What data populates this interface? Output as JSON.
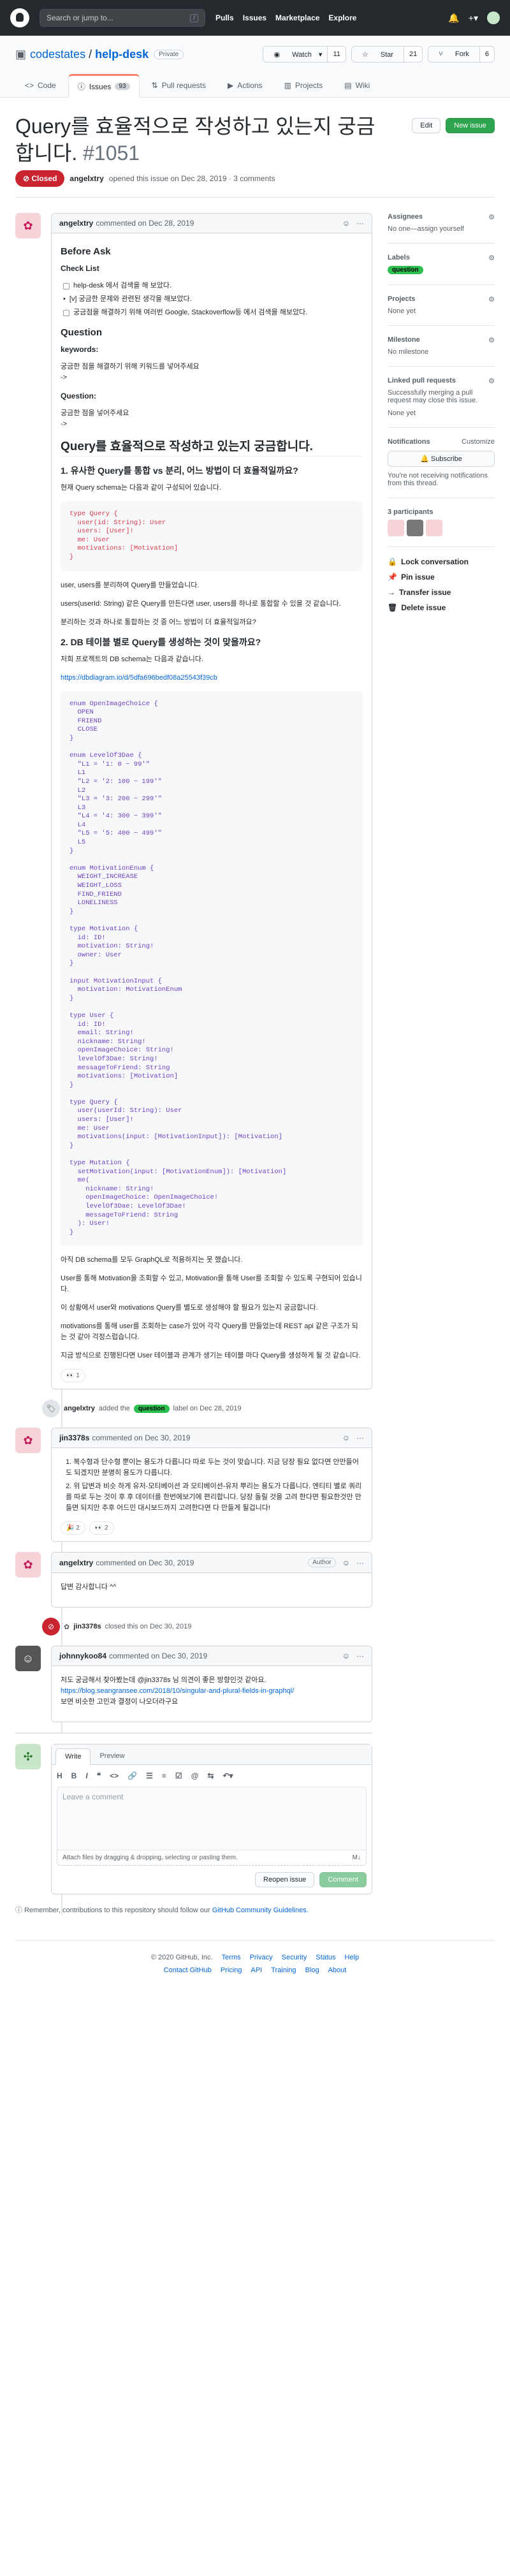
{
  "header": {
    "search_placeholder": "Search or jump to...",
    "slash": "/",
    "nav": [
      "Pulls",
      "Issues",
      "Marketplace",
      "Explore"
    ]
  },
  "repo": {
    "owner": "codestates",
    "sep": " / ",
    "name": "help-desk",
    "visibility": "Private",
    "watch": "Watch",
    "watch_count": "11",
    "star": "Star",
    "star_count": "21",
    "fork": "Fork",
    "fork_count": "6"
  },
  "tabs": [
    {
      "label": "Code"
    },
    {
      "label": "Issues",
      "count": "93"
    },
    {
      "label": "Pull requests"
    },
    {
      "label": "Actions"
    },
    {
      "label": "Projects"
    },
    {
      "label": "Wiki"
    }
  ],
  "issue": {
    "title": "Query를 효율적으로 작성하고 있는지 궁금합니다.",
    "number": "#1051",
    "edit": "Edit",
    "new_issue": "New issue",
    "state": "Closed",
    "author": "angelxtry",
    "opened_text": "opened this issue on Dec 28, 2019 · 3 comments"
  },
  "comment1": {
    "author": "angelxtry",
    "date": "commented on Dec 28, 2019",
    "h_before": "Before Ask",
    "h_check": "Check List",
    "checks": [
      "help-desk 에서 검색을 해 보았다.",
      "[v] 궁금한 문제와 관련된 생각을 해보았다.",
      "궁금점을 해결하기 위해 여러번 Google, Stackoverflow등 에서 검색을 해보았다."
    ],
    "h_question": "Question",
    "kw_label": "keywords:",
    "kw_text": "궁금한 점을 해결하기 위해 키워드를 넣어주세요",
    "arrow1": "->",
    "q_label": "Question:",
    "q_text": "궁금한 점을 넣어주세요",
    "arrow2": "->",
    "h_main": "Query를 효율적으로 작성하고 있는지 궁금합니다.",
    "h_1": "1. 유사한 Query를 통합 vs 분리, 어느 방법이 더 효율적일까요?",
    "p_1": "현재 Query schema는 다음과 같이 구성되어 있습니다.",
    "code1": "type Query {\n  user(id: String): User\n  users: [User]!\n  me: User\n  motivations: [Motivation]\n}",
    "p_2": "user, users를 분리하여 Query를 만들었습니다.",
    "p_3": "users(userId: String) 같은 Query를 만든다면 user, users를 하나로 통합할 수 있을 것 같습니다.",
    "p_4": "분리하는 것과 하나로 통합하는 것 중 어느 방법이 더 효율적일까요?",
    "h_2": "2. DB 테이블 별로 Query를 생성하는 것이 맞을까요?",
    "p_5": "저희 프로젝트의 DB schema는 다음과 같습니다.",
    "link": "https://dbdiagram.io/d/5dfa696bedf08a25543f39cb",
    "code2": "enum OpenImageChoice {\n  OPEN\n  FRIEND\n  CLOSE\n}\n\nenum LevelOf3Dae {\n  \"L1 = '1: 0 ~ 99'\"\n  L1\n  \"L2 = '2: 100 ~ 199'\"\n  L2\n  \"L3 = '3: 200 ~ 299'\"\n  L3\n  \"L4 = '4: 300 ~ 399'\"\n  L4\n  \"L5 = '5: 400 ~ 499'\"\n  L5\n}\n\nenum MotivationEnum {\n  WEIGHT_INCREASE\n  WEIGHT_LOSS\n  FIND_FRIEND\n  LONELINESS\n}\n\ntype Motivation {\n  id: ID!\n  motivation: String!\n  owner: User\n}\n\ninput MotivationInput {\n  motivation: MotivationEnum\n}\n\ntype User {\n  id: ID!\n  email: String!\n  nickname: String!\n  openImageChoice: String!\n  levelOf3Dae: String!\n  messageToFriend: String\n  motivations: [Motivation]\n}\n\ntype Query {\n  user(userId: String): User\n  users: [User]!\n  me: User\n  motivations(input: [MotivationInput]): [Motivation]\n}\n\ntype Mutation {\n  setMotivation(input: [MotivationEnum]): [Motivation]\n  me(\n    nickname: String!\n    openImageChoice: OpenImageChoice!\n    levelOf3Dae: LevelOf3Dae!\n    messageToFriend: String\n  ): User!\n}",
    "p_6": "아직 DB schema를 모두 GraphQL로 적용하지는 못 했습니다.",
    "p_7": "User를 통해 Motivation을 조회할 수 있고, Motivation을 통해 User를 조회할 수 있도록 구현되어 있습니다.",
    "p_8": "이 상황에서 user와 motivations Query를 별도로 생성해야 할 필요가 있는지 궁금합니다.",
    "p_9": "motivations를 통해 user를 조회하는 case가 있어 각각 Query를 만들었는데 REST api 같은 구조가 되는 것 같아 걱정스럽습니다.",
    "p_10": "지금 방식으로 진행된다면 User 테이블과 관계가 생기는 테이블 마다 Query를 생성하게 될 것 같습니다.",
    "reaction": "👀 1"
  },
  "event1": {
    "author": "angelxtry",
    "pre": "added the",
    "label": "question",
    "post": "label on Dec 28, 2019"
  },
  "comment2": {
    "author": "jin3378s",
    "date": "commented on Dec 30, 2019",
    "items": [
      "1. 복수형과 단수형 뿐이는 용도가 다릅니다 따로 두는 것이 맞습니다. 지금 당장 필요 없다면 안만들어도 되겠지만 분명히 용도가 다릅니다.",
      "2. 위 답변과 비슷 하게 유저-모티베이션 과 모티베이션-유저 뿌리는 용도가 다릅니다. 엔티티 별로 쿼리를 따로 두는 것이 후 후 데이터를 한번에보기에 편리합니다. 당장 돌릴 것을 고려 한다면 필요한것만 만들면 되지만 추후 어드민 대시보드까지 고려한다면 다 만들게 될겁니다!"
    ],
    "reactions": [
      "🎉 2",
      "👀 2"
    ]
  },
  "comment3": {
    "author": "angelxtry",
    "date": "commented on Dec 30, 2019",
    "role": "Author",
    "body": "답변 감사합니다 ^^"
  },
  "event2": {
    "author": "jin3378s",
    "text": "closed this on Dec 30, 2019"
  },
  "comment4": {
    "author": "johnnykoo84",
    "date": "commented on Dec 30, 2019",
    "body": "저도 궁금해서 찾아봤는데 @jin3378s 님 의견이 좋은 방향인것 같아요.",
    "link": "https://blog.seangransee.com/2018/10/singular-and-plural-fields-in-graphql/",
    "tail": "보면 비슷한 고민과 결정이 나오더라구요"
  },
  "editor": {
    "tab_write": "Write",
    "tab_preview": "Preview",
    "placeholder": "Leave a comment",
    "attach": "Attach files by dragging & dropping, selecting or pasting them.",
    "reopen": "Reopen issue",
    "submit": "Comment",
    "note": "Remember, contributions to this repository should follow our",
    "note_link": "GitHub Community Guidelines."
  },
  "sidebar": {
    "assignees": "Assignees",
    "assignees_val": "No one—assign yourself",
    "labels": "Labels",
    "label_val": "question",
    "projects": "Projects",
    "projects_val": "None yet",
    "milestone": "Milestone",
    "milestone_val": "No milestone",
    "linked": "Linked pull requests",
    "linked_val": "Successfully merging a pull request may close this issue.",
    "linked_none": "None yet",
    "notif": "Notifications",
    "customize": "Customize",
    "subscribe": "Subscribe",
    "notif_val": "You're not receiving notifications from this thread.",
    "participants": "3 participants",
    "lock": "Lock conversation",
    "pin": "Pin issue",
    "transfer": "Transfer issue",
    "del": "Delete issue"
  },
  "footer": {
    "copy": "© 2020 GitHub, Inc.",
    "links1": [
      "Terms",
      "Privacy",
      "Security",
      "Status",
      "Help"
    ],
    "links2": [
      "Contact GitHub",
      "Pricing",
      "API",
      "Training",
      "Blog",
      "About"
    ]
  }
}
